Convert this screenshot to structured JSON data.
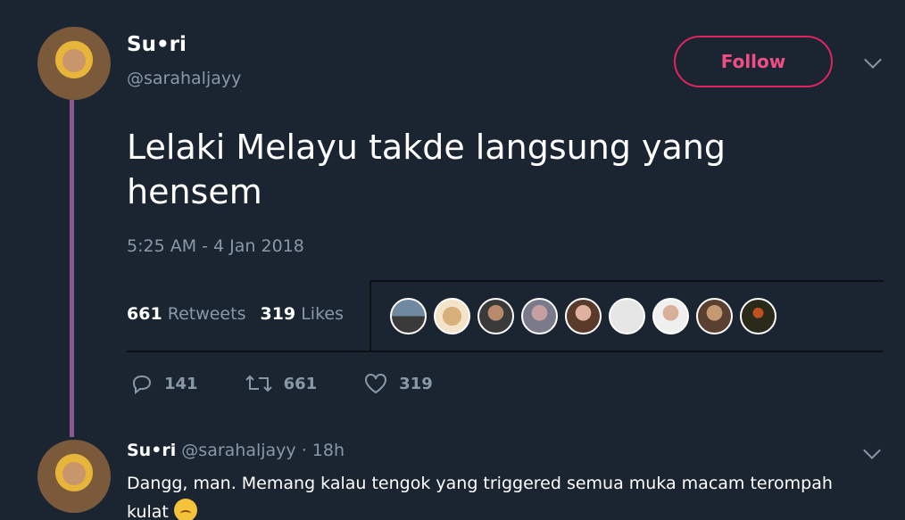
{
  "tweet": {
    "author_name": "Su•ri",
    "author_handle": "@sarahaljayy",
    "follow_label": "Follow",
    "text": "Lelaki Melayu takde langsung yang hensem",
    "timestamp": "5:25 AM - 4 Jan 2018",
    "retweets_count": "661",
    "retweets_label": "Retweets",
    "likes_count": "319",
    "likes_label": "Likes",
    "liker_avatars": [
      "avatar-1",
      "avatar-2",
      "avatar-3",
      "avatar-4",
      "avatar-5",
      "avatar-6",
      "avatar-7",
      "avatar-8",
      "avatar-9"
    ],
    "actions": {
      "replies": "141",
      "retweets": "661",
      "likes": "319"
    }
  },
  "reply": {
    "author_name": "Su•ri",
    "author_handle": "@sarahaljayy",
    "time": "· 18h",
    "text": "Dangg, man. Memang kalau tengok yang triggered semua muka macam terompah kulat"
  },
  "icons": {
    "reply": "reply-icon",
    "retweet": "retweet-icon",
    "like": "heart-icon",
    "menu": "chevron-down-icon",
    "emoji": "crying-face-emoji"
  },
  "colors": {
    "background": "#1b2532",
    "accent": "#e0245e",
    "thread": "#8a5a8d",
    "muted": "#8899a6"
  }
}
